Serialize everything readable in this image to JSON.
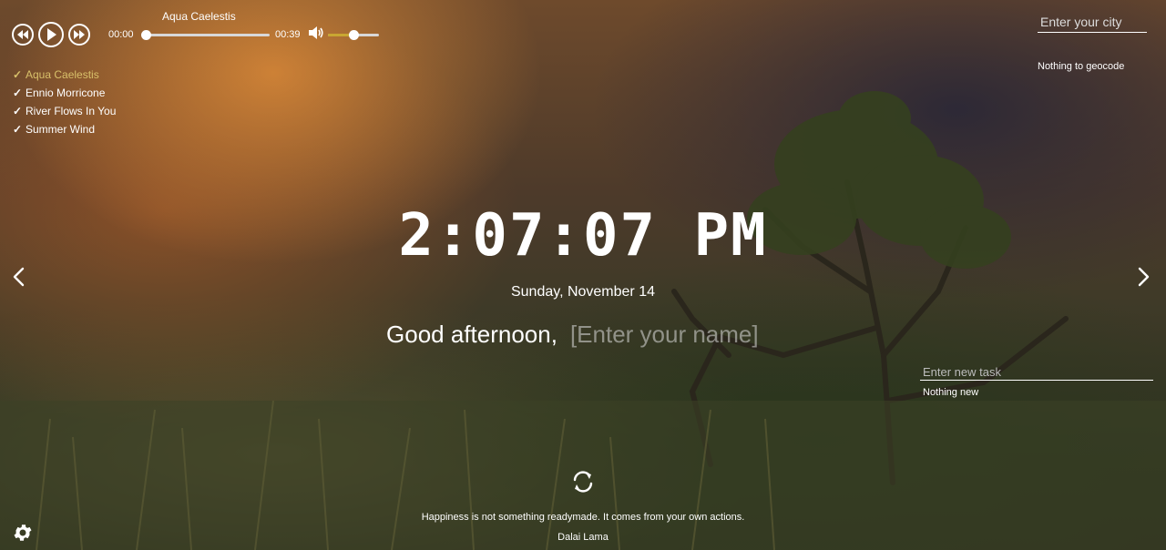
{
  "player": {
    "current_title": "Aqua Caelestis",
    "current_time": "00:00",
    "duration": "00:39",
    "progress_fraction": 0.0,
    "volume_fraction": 0.5,
    "accent_color": "#c8a632",
    "icons": {
      "prev": "rewind-icon",
      "play": "play-icon",
      "next": "fast-forward-icon",
      "volume": "volume-icon"
    }
  },
  "playlist": [
    {
      "check": "✓",
      "label": "Aqua Caelestis",
      "active": true
    },
    {
      "check": "✓",
      "label": "Ennio Morricone",
      "active": false
    },
    {
      "check": "✓",
      "label": "River Flows In You",
      "active": false
    },
    {
      "check": "✓",
      "label": "Summer Wind",
      "active": false
    }
  ],
  "weather": {
    "city_placeholder": "Enter your city",
    "message": "Nothing to geocode"
  },
  "clock": {
    "time": "2:07:07 PM",
    "date": "Sunday, November 14"
  },
  "greeting": {
    "text": "Good afternoon,",
    "name_placeholder": "[Enter your name]"
  },
  "todo": {
    "task_placeholder": "Enter new task",
    "message": "Nothing new"
  },
  "quote": {
    "text": "Happiness is not something readymade. It comes from your own actions.",
    "author": "Dalai Lama"
  },
  "navigation": {
    "prev_icon": "chevron-left-icon",
    "next_icon": "chevron-right-icon"
  },
  "settings": {
    "icon": "gear-icon"
  }
}
